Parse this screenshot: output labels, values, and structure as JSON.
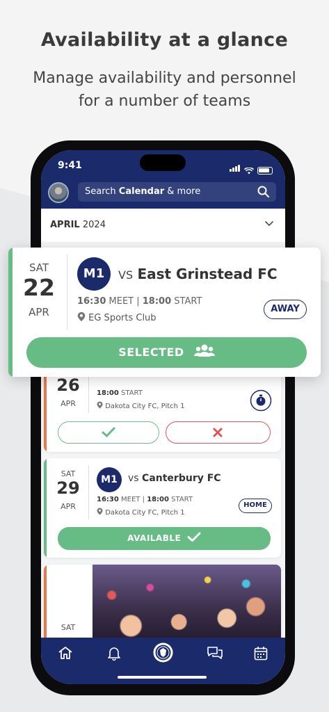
{
  "promo": {
    "headline": "Availability at a glance",
    "subline_1": "Manage availability and personnel",
    "subline_2": "for a number of teams"
  },
  "status_bar": {
    "time": "9:41"
  },
  "header": {
    "search_prefix": "Search ",
    "search_bold": "Calendar",
    "search_suffix": " & more"
  },
  "calendar": {
    "month": "APRIL",
    "year": "2024"
  },
  "featured_event": {
    "dow": "SAT",
    "day": "22",
    "month": "APR",
    "team": "M1",
    "vs": "VS",
    "opponent": "East Grinstead FC",
    "meet_time": "16:30",
    "meet_label": " MEET | ",
    "start_time": "18:00",
    "start_label": " START",
    "location": "EG Sports Club",
    "venue_tag": "AWAY",
    "button_label": "SELECTED"
  },
  "events": [
    {
      "day": "26",
      "month": "APR",
      "start_time": "18:00",
      "start_label": " START",
      "location": "Dakota City FC, Pitch 1"
    },
    {
      "dow": "SAT",
      "day": "29",
      "month": "APR",
      "team": "M1",
      "vs": "vs",
      "opponent": "Canterbury FC",
      "meet_time": "16:30",
      "meet_label": " MEET | ",
      "start_time": "18:00",
      "start_label": " START",
      "location": "Dakota City FC, Pitch 1",
      "venue_tag": "HOME",
      "button_label": "AVAILABLE"
    },
    {
      "dow": "SAT"
    }
  ],
  "colors": {
    "navy": "#1b2a6b",
    "green": "#67bb84",
    "red": "#e05457",
    "orange": "#e8774a"
  }
}
